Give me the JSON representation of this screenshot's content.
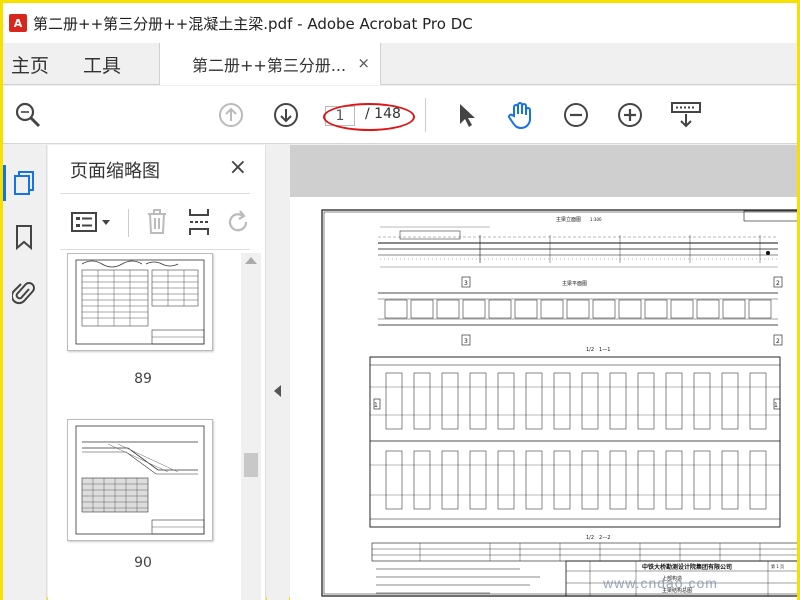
{
  "window": {
    "title": "第二册++第三分册++混凝土主梁.pdf - Adobe Acrobat Pro DC",
    "logo_text": "A"
  },
  "tabs": {
    "home": "主页",
    "tools": "工具",
    "document": "第二册++第三分册...",
    "document_close": "×"
  },
  "toolbar": {
    "current_page": "1",
    "total_pages": "/ 148"
  },
  "icons": {
    "search": "search-icon",
    "prev": "arrow-up-circle-icon",
    "next": "arrow-down-circle-icon",
    "select": "cursor-arrow-icon",
    "hand": "hand-icon",
    "zoom_out": "zoom-out-icon",
    "zoom_in": "zoom-in-icon",
    "keyboard": "keyboard-scroll-icon"
  },
  "panel": {
    "title": "页面缩略图",
    "close": "×",
    "thumbnails": [
      {
        "label": "89"
      },
      {
        "label": "90"
      }
    ]
  },
  "drawing": {
    "title_top": "主梁立面图",
    "scale_top": "1:300",
    "section_title": "主梁平面图",
    "section_a": "1/2　1—1",
    "section_b": "1/2　2—2",
    "company": "中铁大桥勘测设计院集团有限公司",
    "drawing_name": "主梁结构总图",
    "project": "上部构造",
    "sheet": "第 1 页",
    "marks": [
      "3",
      "3",
      "2",
      "2",
      "1",
      "1"
    ]
  },
  "watermark": {
    "text": "www.cndao.com"
  },
  "colors": {
    "accent": "#1473e6",
    "annotation": "#e01414",
    "highlight_border": "#f5e000"
  }
}
